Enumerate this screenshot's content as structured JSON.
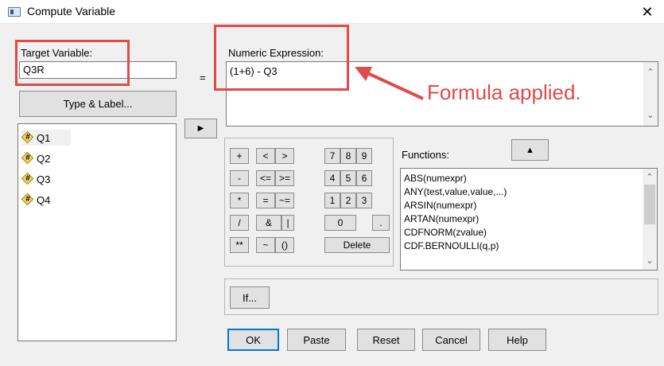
{
  "window": {
    "title": "Compute Variable",
    "close_glyph": "✕"
  },
  "target": {
    "label": "Target Variable:",
    "value": "Q3R",
    "type_label_button": "Type & Label..."
  },
  "equals": "=",
  "expression": {
    "label": "Numeric Expression:",
    "value": "(1+6) - Q3"
  },
  "annotation": {
    "text": "Formula applied.",
    "color": "#e04a4a"
  },
  "variables": [
    "Q1",
    "Q2",
    "Q3",
    "Q4"
  ],
  "move_button_glyph": "▶",
  "keypad": {
    "row1": [
      "+",
      "<",
      ">",
      "7",
      "8",
      "9"
    ],
    "row2": [
      "-",
      "<=",
      ">=",
      "4",
      "5",
      "6"
    ],
    "row3": [
      "*",
      "=",
      "~=",
      "1",
      "2",
      "3"
    ],
    "row4": [
      "/",
      "&",
      "|",
      "0",
      "."
    ],
    "row5": [
      "**",
      "~",
      "()",
      "Delete"
    ]
  },
  "functions": {
    "label": "Functions:",
    "up_glyph": "▲",
    "items": [
      "ABS(numexpr)",
      "ANY(test,value,value,...)",
      "ARSIN(numexpr)",
      "ARTAN(numexpr)",
      "CDFNORM(zvalue)",
      "CDF.BERNOULLI(q,p)"
    ]
  },
  "if_button": "If...",
  "bottom_buttons": {
    "ok": "OK",
    "paste": "Paste",
    "reset": "Reset",
    "cancel": "Cancel",
    "help": "Help"
  },
  "icons": {
    "app": "window-app-icon",
    "variable": "numeric-variable-icon",
    "move": "right-arrow-icon"
  }
}
